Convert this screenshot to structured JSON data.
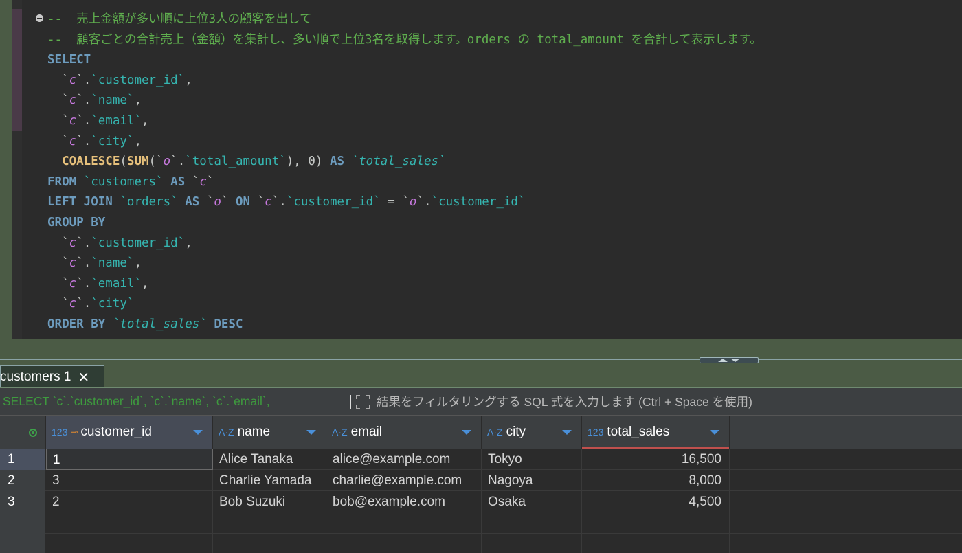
{
  "editor": {
    "lines": [
      [
        {
          "c": "cm",
          "t": "--  売上金額が多い順に上位3人の顧客を出して"
        }
      ],
      [
        {
          "c": "cm",
          "t": "--  顧客ごとの合計売上（金額）を集計し、多い順で上位3名を取得します。orders の total_amount を合計して表示します。"
        }
      ],
      [
        {
          "c": "kw",
          "t": "SELECT"
        }
      ],
      [
        {
          "c": "pn",
          "t": "  `"
        },
        {
          "c": "al",
          "t": "c"
        },
        {
          "c": "pn",
          "t": "`."
        },
        {
          "c": "id",
          "t": "`customer_id`"
        },
        {
          "c": "pn",
          "t": ","
        }
      ],
      [
        {
          "c": "pn",
          "t": "  `"
        },
        {
          "c": "al",
          "t": "c"
        },
        {
          "c": "pn",
          "t": "`."
        },
        {
          "c": "id",
          "t": "`name`"
        },
        {
          "c": "pn",
          "t": ","
        }
      ],
      [
        {
          "c": "pn",
          "t": "  `"
        },
        {
          "c": "al",
          "t": "c"
        },
        {
          "c": "pn",
          "t": "`."
        },
        {
          "c": "id",
          "t": "`email`"
        },
        {
          "c": "pn",
          "t": ","
        }
      ],
      [
        {
          "c": "pn",
          "t": "  `"
        },
        {
          "c": "al",
          "t": "c"
        },
        {
          "c": "pn",
          "t": "`."
        },
        {
          "c": "id",
          "t": "`city`"
        },
        {
          "c": "pn",
          "t": ","
        }
      ],
      [
        {
          "c": "pn",
          "t": "  "
        },
        {
          "c": "fn",
          "t": "COALESCE"
        },
        {
          "c": "pn",
          "t": "("
        },
        {
          "c": "fn",
          "t": "SUM"
        },
        {
          "c": "pn",
          "t": "(`"
        },
        {
          "c": "al",
          "t": "o"
        },
        {
          "c": "pn",
          "t": "`."
        },
        {
          "c": "id",
          "t": "`total_amount`"
        },
        {
          "c": "pn",
          "t": "), 0) "
        },
        {
          "c": "kw",
          "t": "AS"
        },
        {
          "c": "pn",
          "t": " "
        },
        {
          "c": "ti",
          "t": "`total_sales`"
        }
      ],
      [
        {
          "c": "kw",
          "t": "FROM"
        },
        {
          "c": "pn",
          "t": " "
        },
        {
          "c": "id",
          "t": "`customers`"
        },
        {
          "c": "pn",
          "t": " "
        },
        {
          "c": "kw",
          "t": "AS"
        },
        {
          "c": "pn",
          "t": " `"
        },
        {
          "c": "al",
          "t": "c"
        },
        {
          "c": "pn",
          "t": "`"
        }
      ],
      [
        {
          "c": "kw",
          "t": "LEFT JOIN"
        },
        {
          "c": "pn",
          "t": " "
        },
        {
          "c": "id",
          "t": "`orders`"
        },
        {
          "c": "pn",
          "t": " "
        },
        {
          "c": "kw",
          "t": "AS"
        },
        {
          "c": "pn",
          "t": " `"
        },
        {
          "c": "al",
          "t": "o"
        },
        {
          "c": "pn",
          "t": "` "
        },
        {
          "c": "kw",
          "t": "ON"
        },
        {
          "c": "pn",
          "t": " `"
        },
        {
          "c": "al",
          "t": "c"
        },
        {
          "c": "pn",
          "t": "`."
        },
        {
          "c": "id",
          "t": "`customer_id`"
        },
        {
          "c": "pn",
          "t": " = `"
        },
        {
          "c": "al",
          "t": "o"
        },
        {
          "c": "pn",
          "t": "`."
        },
        {
          "c": "id",
          "t": "`customer_id`"
        }
      ],
      [
        {
          "c": "kw",
          "t": "GROUP BY"
        }
      ],
      [
        {
          "c": "pn",
          "t": "  `"
        },
        {
          "c": "al",
          "t": "c"
        },
        {
          "c": "pn",
          "t": "`."
        },
        {
          "c": "id",
          "t": "`customer_id`"
        },
        {
          "c": "pn",
          "t": ","
        }
      ],
      [
        {
          "c": "pn",
          "t": "  `"
        },
        {
          "c": "al",
          "t": "c"
        },
        {
          "c": "pn",
          "t": "`."
        },
        {
          "c": "id",
          "t": "`name`"
        },
        {
          "c": "pn",
          "t": ","
        }
      ],
      [
        {
          "c": "pn",
          "t": "  `"
        },
        {
          "c": "al",
          "t": "c"
        },
        {
          "c": "pn",
          "t": "`."
        },
        {
          "c": "id",
          "t": "`email`"
        },
        {
          "c": "pn",
          "t": ","
        }
      ],
      [
        {
          "c": "pn",
          "t": "  `"
        },
        {
          "c": "al",
          "t": "c"
        },
        {
          "c": "pn",
          "t": "`."
        },
        {
          "c": "id",
          "t": "`city`"
        }
      ],
      [
        {
          "c": "kw",
          "t": "ORDER BY"
        },
        {
          "c": "pn",
          "t": " "
        },
        {
          "c": "ti",
          "t": "`total_sales`"
        },
        {
          "c": "pn",
          "t": " "
        },
        {
          "c": "kw",
          "t": "DESC"
        }
      ]
    ]
  },
  "results": {
    "tab_label": "customers 1",
    "filter_text": "SELECT `c`.`customer_id`, `c`.`name`, `c`.`email`,",
    "filter_placeholder": "結果をフィルタリングする SQL 式を入力します (Ctrl + Space を使用)",
    "columns": [
      {
        "type": "123",
        "name": "customer_id",
        "key": "⊸"
      },
      {
        "type": "A·Z",
        "name": "name"
      },
      {
        "type": "A·Z",
        "name": "email"
      },
      {
        "type": "A·Z",
        "name": "city"
      },
      {
        "type": "123",
        "name": "total_sales"
      }
    ],
    "rows": [
      {
        "num": "1",
        "cells": [
          "1",
          "Alice Tanaka",
          "alice@example.com",
          "Tokyo",
          "16,500"
        ]
      },
      {
        "num": "2",
        "cells": [
          "3",
          "Charlie Yamada",
          "charlie@example.com",
          "Nagoya",
          "8,000"
        ]
      },
      {
        "num": "3",
        "cells": [
          "2",
          "Bob Suzuki",
          "bob@example.com",
          "Osaka",
          "4,500"
        ]
      }
    ]
  },
  "colors": {
    "background": "#2b2b2b",
    "panel_green": "#4b5b45",
    "keyword": "#6d9cbe",
    "identifier": "#35b5b0",
    "alias": "#c678dd",
    "function": "#e6c07b",
    "comment": "#5fae4e"
  }
}
